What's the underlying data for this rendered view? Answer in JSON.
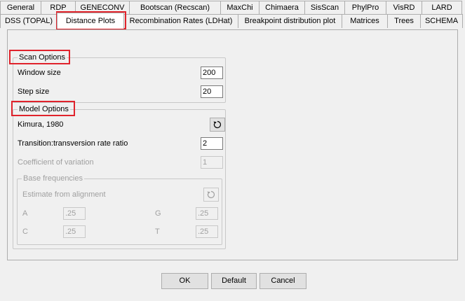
{
  "tabs_row1": [
    "General",
    "RDP",
    "GENECONV",
    "Bootscan (Recscan)",
    "MaxChi",
    "Chimaera",
    "SisScan",
    "PhylPro",
    "VisRD",
    "LARD"
  ],
  "tabs_row2": [
    "DSS (TOPAL)",
    "Distance Plots",
    "Recombination Rates (LDHat)",
    "Breakpoint distribution plot",
    "Matrices",
    "Trees",
    "SCHEMA"
  ],
  "active_tab": "Distance Plots",
  "scan_options": {
    "title": "Scan Options",
    "window_size_label": "Window size",
    "window_size_value": "200",
    "step_size_label": "Step size",
    "step_size_value": "20"
  },
  "model_options": {
    "title": "Model Options",
    "model_name": "Kimura, 1980",
    "ttratio_label": "Transition:transversion rate ratio",
    "ttratio_value": "2",
    "cv_label": "Coefficient of variation",
    "cv_value": "1",
    "base_freq": {
      "title": "Base frequencies",
      "estimate_label": "Estimate from alignment",
      "a_label": "A",
      "a_value": ".25",
      "c_label": "C",
      "c_value": ".25",
      "g_label": "G",
      "g_value": ".25",
      "t_label": "T",
      "t_value": ".25"
    }
  },
  "buttons": {
    "ok": "OK",
    "default": "Default",
    "cancel": "Cancel"
  },
  "highlight_color": "#e0232c",
  "icons": {
    "cycle": "cycle-icon"
  }
}
